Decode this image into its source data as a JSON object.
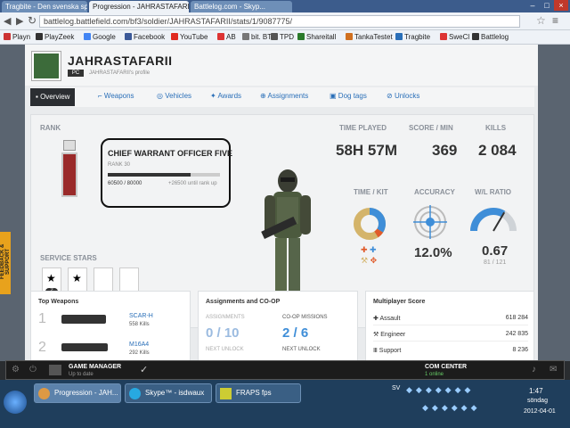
{
  "browser": {
    "tabs": [
      {
        "label": "Tragbite - Den svenska spelp..."
      },
      {
        "label": "Progression - JAHRASTAFARII"
      },
      {
        "label": "Battlelog.com - Skyp..."
      }
    ],
    "url": "battlelog.battlefield.com/bf3/soldier/JAHRASTAFARII/stats/1/9087775/",
    "bookmarks": [
      "Playn",
      "PlayZeek",
      "Google",
      "Facebook",
      "YouTube",
      "AB",
      "bit. BT",
      "TPD",
      "Shareitall",
      "TankaTestet",
      "Tragbite",
      "SweCl",
      "Battlelog"
    ]
  },
  "profile": {
    "username": "JAHRASTAFARII",
    "platform": "PC",
    "subline": "JAHRASTAFARII's profile"
  },
  "nav": {
    "items": [
      {
        "label": "Overview"
      },
      {
        "label": "Weapons"
      },
      {
        "label": "Vehicles"
      },
      {
        "label": "Awards"
      },
      {
        "label": "Assignments"
      },
      {
        "label": "Dog tags"
      },
      {
        "label": "Unlocks"
      }
    ]
  },
  "rank": {
    "heading": "RANK",
    "title": "CHIEF WARRANT OFFICER FIVE",
    "rank_num": "RANK 30",
    "progress_text": "60500 / 80000",
    "remaining_text": "+26500 until rank up",
    "progress_fraction": 0.74
  },
  "service_stars": {
    "heading": "SERVICE STARS",
    "count_badge": "2"
  },
  "stats": {
    "time_played_label": "TIME PLAYED",
    "time_played": "58H 57M",
    "score_min_label": "SCORE / MIN",
    "score_min": "369",
    "kills_label": "KILLS",
    "kills": "2 084",
    "time_kit_label": "TIME / KIT",
    "accuracy_label": "ACCURACY",
    "accuracy": "12.0%",
    "wl_label": "W/L RATIO",
    "wl": "0.67",
    "wl_sub": "81 / 121"
  },
  "top_weapons": {
    "heading": "Top Weapons",
    "items": [
      {
        "num": "1",
        "name": "SCAR-H",
        "kills": "558 Kills"
      },
      {
        "num": "2",
        "name": "M16A4",
        "kills": "292 Kills"
      }
    ]
  },
  "assignments": {
    "heading": "Assignments and CO-OP",
    "left_label": "ASSIGNMENTS",
    "left_value": "0 / 10",
    "left_next": "NEXT UNLOCK",
    "right_label": "CO-OP MISSIONS",
    "right_value": "2 / 6",
    "right_next": "NEXT UNLOCK"
  },
  "multiplayer": {
    "heading": "Multiplayer Score",
    "rows": [
      {
        "name": "Assault",
        "value": "618 284"
      },
      {
        "name": "Engineer",
        "value": "242 835"
      },
      {
        "name": "Support",
        "value": "8 236"
      }
    ]
  },
  "overlay": {
    "game_manager": "GAME MANAGER",
    "game_manager_sub": "Up to date",
    "com_center": "COM CENTER",
    "com_center_sub": "1 online"
  },
  "feedback": "FEEDBACK & SUPPORT",
  "taskbar": {
    "items": [
      {
        "label": "Progression - JAH..."
      },
      {
        "label": "Skype™ - isdwaux"
      },
      {
        "label": "FRAPS fps"
      }
    ],
    "lang": "SV",
    "time": "1:47",
    "day": "söndag",
    "date": "2012-04-01"
  }
}
